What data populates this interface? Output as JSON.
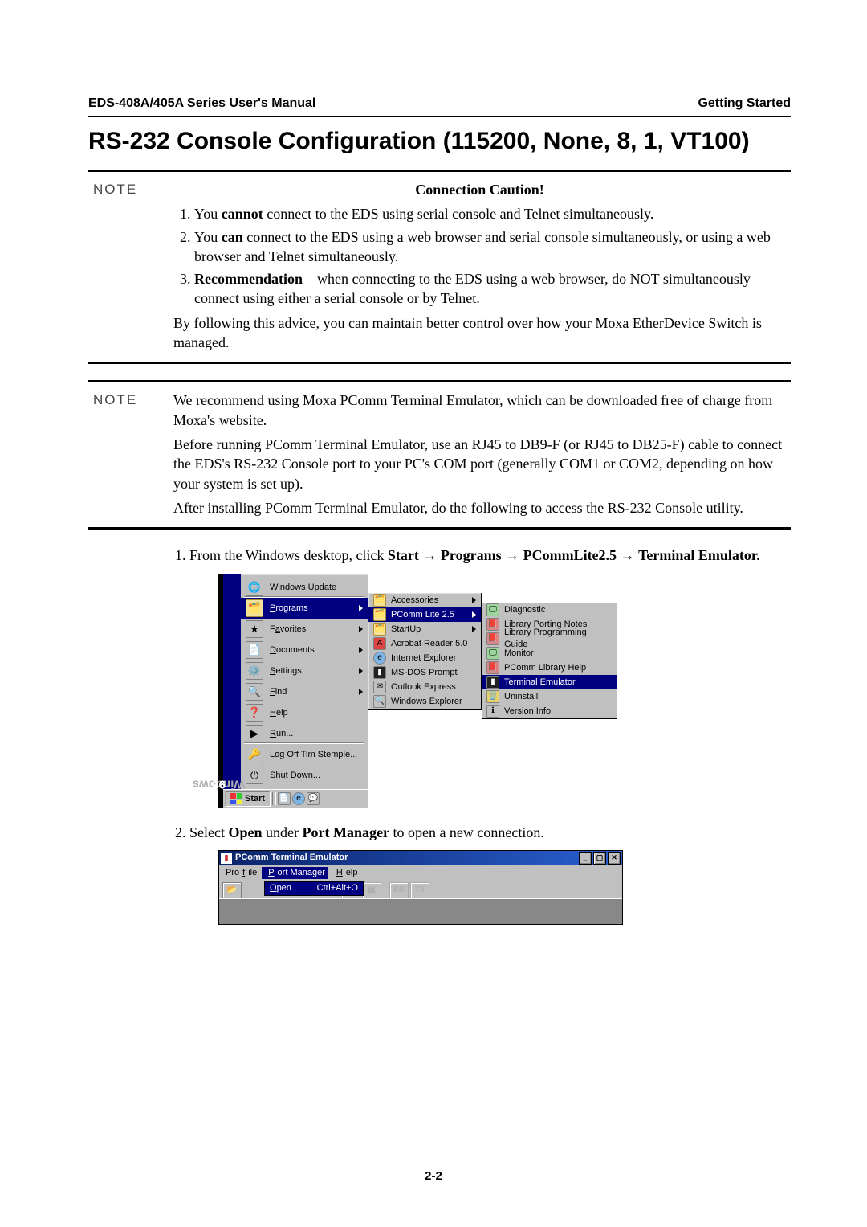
{
  "header": {
    "left": "EDS-408A/405A Series User's Manual",
    "right": "Getting Started"
  },
  "title": "RS-232 Console Configuration (115200, None, 8, 1, VT100)",
  "note1": {
    "label": "NOTE",
    "caution": "Connection Caution!",
    "item1_pre": "You ",
    "item1_bold": "cannot",
    "item1_post": " connect to the EDS using serial console and Telnet simultaneously.",
    "item2_pre": "You ",
    "item2_bold": "can",
    "item2_post": " connect to the EDS using a web browser and serial console simultaneously, or using a web browser and Telnet simultaneously.",
    "item3_bold": "Recommendation",
    "item3_post": "—when connecting to the EDS using a web browser, do NOT simultaneously connect using either a serial console or by Telnet.",
    "follow": "By following this advice, you can maintain better control over how your Moxa EtherDevice Switch is managed."
  },
  "note2": {
    "label": "NOTE",
    "p1": "We recommend using Moxa PComm Terminal Emulator, which can be downloaded free of charge from Moxa's website.",
    "p2": "Before running PComm Terminal Emulator, use an RJ45 to DB9-F (or RJ45 to DB25-F) cable to connect the EDS's RS-232 Console port to your PC's COM port (generally COM1 or COM2, depending on how your system is set up).",
    "p3": "After installing PComm Terminal Emulator, do the following to access the RS-232 Console utility."
  },
  "step1": {
    "pre": "From the Windows desktop, click ",
    "b1": "Start",
    "arrow": " → ",
    "b2": "Programs",
    "b3": "PCommLite2.5",
    "b4": "Terminal Emulator."
  },
  "step2": {
    "pre": "Select ",
    "b1": "Open",
    "mid": " under ",
    "b2": "Port Manager",
    "post": " to open a new connection."
  },
  "startmenu": {
    "update": "Windows Update",
    "programs": "Programs",
    "favorites": "Favorites",
    "documents": "Documents",
    "settings": "Settings",
    "find": "Find",
    "help": "Help",
    "run": "Run...",
    "logoff": "Log Off Tim Stemple...",
    "shutdown": "Shut Down...",
    "startbtn": "Start",
    "sideband_a": "Windows",
    "sideband_b": "98"
  },
  "programs_menu": {
    "accessories": "Accessories",
    "pcomm": "PComm Lite 2.5",
    "startup": "StartUp",
    "acrobat": "Acrobat Reader 5.0",
    "ie": "Internet Explorer",
    "msdos": "MS-DOS Prompt",
    "outlook": "Outlook Express",
    "explorer": "Windows Explorer"
  },
  "pcomm_menu": {
    "diagnostic": "Diagnostic",
    "porting": "Library Porting Notes",
    "progguide": "Library Programming Guide",
    "monitor": "Monitor",
    "libhelp": "PComm Library Help",
    "terminal": "Terminal Emulator",
    "uninstall": "Uninstall",
    "version": "Version Info"
  },
  "pcomm_window": {
    "title": "PComm Terminal Emulator",
    "menu_profile": "Profile",
    "menu_portmgr": "Port Manager",
    "menu_help": "Help",
    "open": "Open",
    "shortcut": "Ctrl+Alt+O"
  },
  "footer": "2-2"
}
